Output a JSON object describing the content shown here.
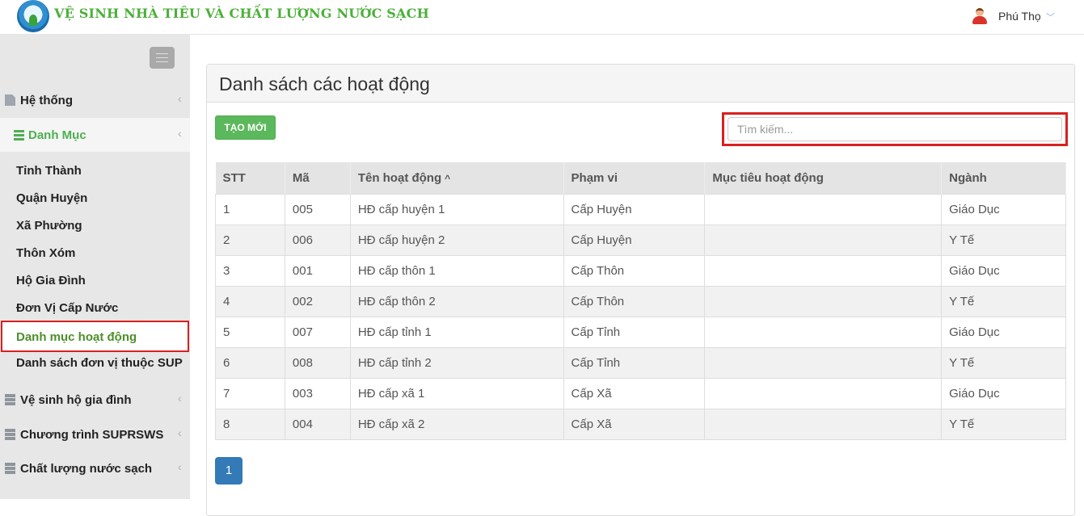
{
  "header": {
    "app_title": "VỆ SINH NHÀ TIÊU VÀ CHẤT LƯỢNG NƯỚC SẠCH",
    "user_name": "Phú Thọ",
    "user_caret": "﹀",
    "accent": "#4caf3a"
  },
  "sidebar": {
    "chevron": "‹",
    "items": [
      {
        "label": "Hệ thống",
        "icon": "document-icon"
      },
      {
        "label": "Danh Mục",
        "icon": "list-icon",
        "active": true
      },
      {
        "label": "Vệ sinh hộ gia đình",
        "icon": "server-icon"
      },
      {
        "label": "Chương trình SUPRSWS",
        "icon": "server-icon"
      },
      {
        "label": "Chất lượng nước sạch",
        "icon": "server-icon"
      }
    ],
    "sub_items": [
      "Tỉnh Thành",
      "Quận Huyện",
      "Xã Phường",
      "Thôn Xóm",
      "Hộ Gia Đình",
      "Đơn Vị Cấp Nước",
      "Danh mục hoạt động",
      "Danh sách đơn vị thuộc SUP"
    ],
    "selected_sub_item": "Danh mục hoạt động"
  },
  "main": {
    "title": "Danh sách các hoạt động",
    "create_button": "TẠO MỚI",
    "search_placeholder": "Tìm kiếm...",
    "sort_indicator": "^",
    "columns": [
      "STT",
      "Mã",
      "Tên hoạt động",
      "Phạm vi",
      "Mục tiêu hoạt động",
      "Ngành"
    ],
    "rows": [
      [
        "1",
        "005",
        "HĐ cấp huyện 1",
        "Cấp Huyện",
        "",
        "Giáo Dục"
      ],
      [
        "2",
        "006",
        "HĐ cấp huyện 2",
        "Cấp Huyện",
        "",
        "Y Tế"
      ],
      [
        "3",
        "001",
        "HĐ cấp thôn 1",
        "Cấp Thôn",
        "",
        "Giáo Dục"
      ],
      [
        "4",
        "002",
        "HĐ cấp thôn 2",
        "Cấp Thôn",
        "",
        "Y Tế"
      ],
      [
        "5",
        "007",
        "HĐ cấp tỉnh 1",
        "Cấp Tỉnh",
        "",
        "Giáo Dục"
      ],
      [
        "6",
        "008",
        "HĐ cấp tỉnh 2",
        "Cấp Tỉnh",
        "",
        "Y Tế"
      ],
      [
        "7",
        "003",
        "HĐ cấp xã 1",
        "Cấp Xã",
        "",
        "Giáo Dục"
      ],
      [
        "8",
        "004",
        "HĐ cấp xã 2",
        "Cấp Xã",
        "",
        "Y Tế"
      ]
    ],
    "current_page": "1"
  },
  "colors": {
    "brand_green": "#4caf50",
    "button_green": "#5cb85c",
    "page_blue": "#337ab7",
    "highlight_red": "#d9201f"
  }
}
